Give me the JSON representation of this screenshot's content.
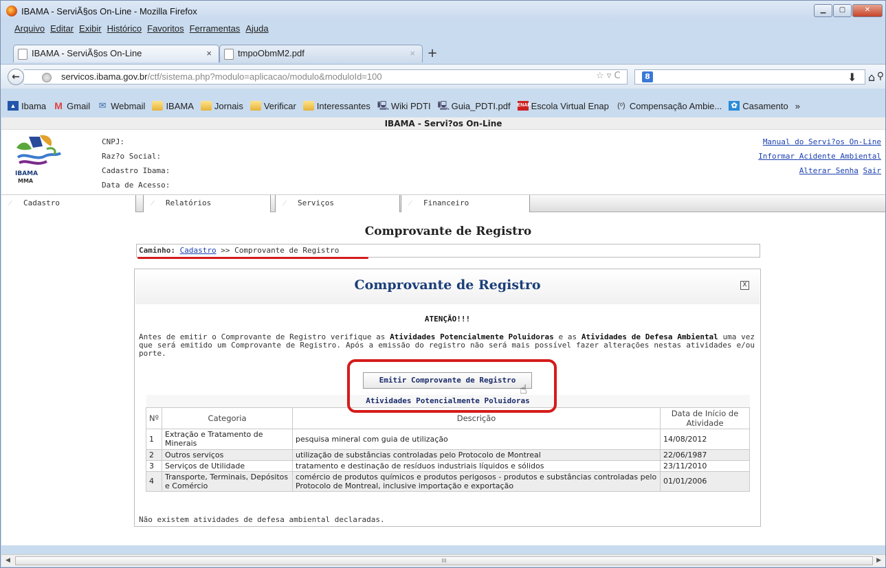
{
  "window": {
    "title": "IBAMA - ServiÃ§os On-Line - Mozilla Firefox"
  },
  "menubar": [
    "Arquivo",
    "Editar",
    "Exibir",
    "Histórico",
    "Favoritos",
    "Ferramentas",
    "Ajuda"
  ],
  "tabs": [
    {
      "label": "IBAMA - ServiÃ§os On-Line",
      "close": "×"
    },
    {
      "label": "tmpoObmM2.pdf",
      "close": "×"
    }
  ],
  "newtab": "+",
  "url": {
    "domain": "servicos.ibama.gov.br",
    "path": "/ctf/sistema.php?modulo=aplicacao/modulo&moduloId=100"
  },
  "bookmarks": [
    {
      "label": "Ibama",
      "icon": "ibama-icon"
    },
    {
      "label": "Gmail",
      "icon": "gmail-icon"
    },
    {
      "label": "Webmail",
      "icon": "mail-icon"
    },
    {
      "label": "IBAMA",
      "icon": "folder-icon"
    },
    {
      "label": "Jornais",
      "icon": "folder-icon"
    },
    {
      "label": "Verificar",
      "icon": "folder-icon"
    },
    {
      "label": "Interessantes",
      "icon": "folder-icon"
    },
    {
      "label": "Wiki PDTI",
      "icon": "monitor-icon"
    },
    {
      "label": "Guia_PDTI.pdf",
      "icon": "monitor-icon"
    },
    {
      "label": "Escola Virtual Enap",
      "icon": "enap-icon"
    },
    {
      "label": "Compensação Ambie...",
      "icon": "wifi-icon"
    },
    {
      "label": "Casamento",
      "icon": "casamento-icon"
    }
  ],
  "bookmarks_more": "»",
  "page": {
    "header_title": "IBAMA - Servi?os On-Line",
    "logo_text": "IBAMA",
    "logo_sub": "MMA",
    "info_labels": [
      "CNPJ:",
      "Raz?o Social:",
      "Cadastro Ibama:",
      "Data de Acesso:"
    ],
    "right_links": {
      "manual": "Manual do Servi?os On-Line",
      "acidente": "Informar Acidente Ambiental",
      "senha": "Alterar Senha",
      "sair": "Sair"
    },
    "menu": [
      "Cadastro",
      "Relatórios",
      "Serviços",
      "Financeiro"
    ],
    "title": "Comprovante de Registro",
    "breadcrumb": {
      "label": "Caminho:",
      "link": "Cadastro",
      "rest": " >> Comprovante de Registro"
    },
    "panel": {
      "title": "Comprovante de Registro",
      "close": "X",
      "atencao": "ATENÇÃO!!!",
      "aviso_1": "Antes de emitir o Comprovante de Registro verifique as ",
      "aviso_b1": "Atividades Potencialmente Poluidoras",
      "aviso_2": " e as ",
      "aviso_b2": "Atividades de Defesa Ambiental",
      "aviso_3": " uma vez que será emitido um Comprovante de Registro. Após a emissão do registro não será mais possível fazer alterações nestas atividades e/ou porte.",
      "emit_button": "Emitir Comprovante de Registro",
      "table_caption": "Atividades Potencialmente Poluidoras",
      "columns": [
        "Nº",
        "Categoria",
        "Descrição",
        "Data de Início de Atividade"
      ],
      "rows": [
        {
          "n": "1",
          "categoria": "Extração e Tratamento de Minerais",
          "descricao": "pesquisa mineral com guia de utilização",
          "data": "14/08/2012"
        },
        {
          "n": "2",
          "categoria": "Outros serviços",
          "descricao": "utilização de substâncias controladas pelo Protocolo de Montreal",
          "data": "22/06/1987"
        },
        {
          "n": "3",
          "categoria": "Serviços de Utilidade",
          "descricao": "tratamento e destinação de resíduos industriais líquidos e sólidos",
          "data": "23/11/2010"
        },
        {
          "n": "4",
          "categoria": "Transporte, Terminais, Depósitos e Comércio",
          "descricao": "comércio de produtos químicos e produtos perigosos - produtos e substâncias controladas pelo Protocolo de Montreal, inclusive importação e exportação",
          "data": "01/01/2006"
        }
      ],
      "no_defesa": "Não existem atividades de defesa ambiental declaradas."
    }
  },
  "scrollbar": {
    "grip": "III"
  }
}
